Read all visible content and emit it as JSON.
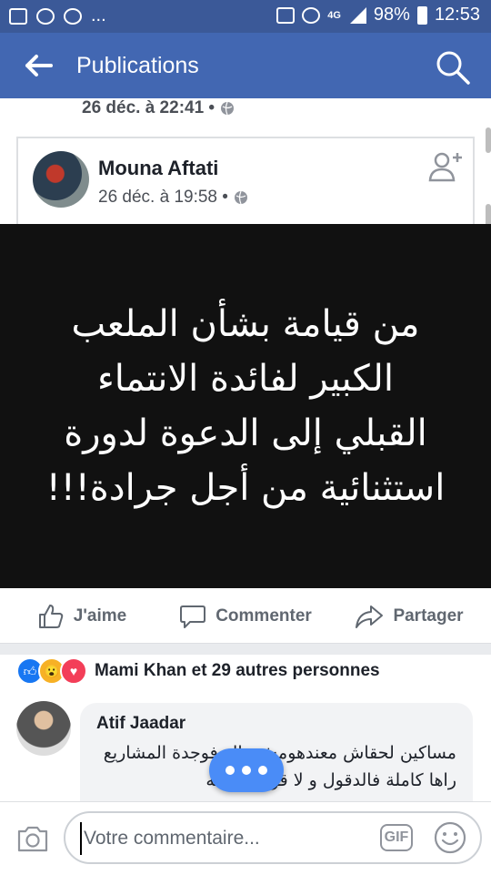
{
  "status_bar": {
    "battery": "98%",
    "time": "12:53",
    "dots": "...",
    "network": "4G"
  },
  "header": {
    "title": "Publications"
  },
  "previous_post": {
    "date": "26 déc. à 22:41 •"
  },
  "post": {
    "author": "Mouna Aftati",
    "date": "26 déc. à 19:58 •",
    "image_text": "من قيامة بشأن الملعب الكبير لفائدة الانتماء القبلي إلى الدعوة لدورة استثنائية من أجل جرادة!!!"
  },
  "actions": {
    "like": "J'aime",
    "comment": "Commenter",
    "share": "Partager"
  },
  "reactions": {
    "summary": "Mami Khan et 29 autres personnes"
  },
  "comment": {
    "author": "Atif Jaadar",
    "text": "مساكين لحقاش معندهومش والو فوجدة المشاريع راها كاملة فالدقول و لا قوة الا بالله"
  },
  "composer": {
    "placeholder": "Votre commentaire...",
    "gif_label": "GIF"
  },
  "colors": {
    "brand": "#4267b2",
    "status": "#3b5998",
    "fab": "#4a8cf7"
  }
}
